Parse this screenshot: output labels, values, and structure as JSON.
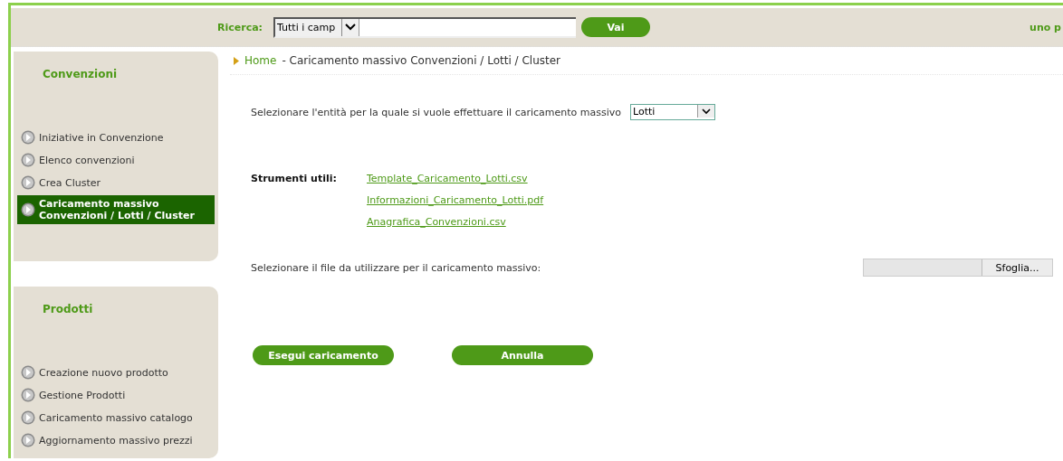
{
  "header": {
    "search_label": "Ricerca:",
    "search_scope": {
      "value": "Tutti i camp"
    },
    "go_button": "Vai",
    "right_text": "uno p"
  },
  "sidebar": [
    {
      "title": "Convenzioni",
      "items": [
        {
          "label": "Iniziative in Convenzione",
          "selected": false
        },
        {
          "label": "Elenco convenzioni",
          "selected": false
        },
        {
          "label": "Crea Cluster",
          "selected": false
        },
        {
          "label": "Caricamento massivo Convenzioni / Lotti / Cluster",
          "selected": true
        }
      ]
    },
    {
      "title": "Prodotti",
      "items": [
        {
          "label": "Creazione nuovo prodotto",
          "selected": false
        },
        {
          "label": "Gestione Prodotti",
          "selected": false
        },
        {
          "label": "Caricamento massivo catalogo",
          "selected": false
        },
        {
          "label": "Aggiornamento massivo prezzi",
          "selected": false
        }
      ]
    }
  ],
  "breadcrumb": {
    "home": "Home",
    "current": "- Caricamento massivo Convenzioni / Lotti / Cluster"
  },
  "entity": {
    "label": "Selezionare l'entità per la quale si vuole effettuare il caricamento massivo",
    "value": "Lotti"
  },
  "tools": {
    "label": "Strumenti utili:",
    "links": [
      "Template_Caricamento_Lotti.csv",
      "Informazioni_Caricamento_Lotti.pdf",
      "Anagrafica_Convenzioni.csv"
    ]
  },
  "file": {
    "label": "Selezionare il file da utilizzare per il caricamento massivo:",
    "browse_button": "Sfoglia..."
  },
  "buttons": [
    "Esegui caricamento",
    "Annulla"
  ]
}
